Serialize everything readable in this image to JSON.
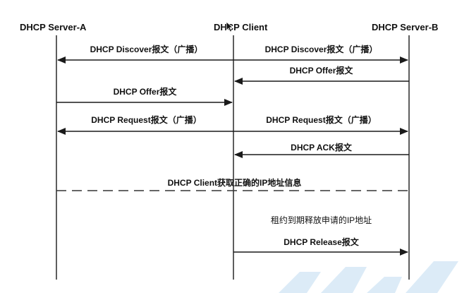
{
  "participants": {
    "server_a": "DHCP Server-A",
    "client": "DHCP Client",
    "server_b": "DHCP Server-B"
  },
  "messages": {
    "discover_left": "DHCP Discover报文（广播）",
    "discover_right": "DHCP Discover报文（广播）",
    "offer_b": "DHCP Offer报文",
    "offer_a": "DHCP Offer报文",
    "request_left": "DHCP Request报文（广播）",
    "request_right": "DHCP Request报文（广播）",
    "ack_b": "DHCP ACK报文",
    "ip_obtained": "DHCP Client获取正确的IP地址信息",
    "lease_note": "租约到期释放申请的IP地址",
    "release": "DHCP Release报文"
  },
  "colors": {
    "line": "#1a1a1a",
    "dash": "#333333",
    "watermark": "#cfe3f3"
  },
  "icons": [
    "cursor-icon"
  ]
}
